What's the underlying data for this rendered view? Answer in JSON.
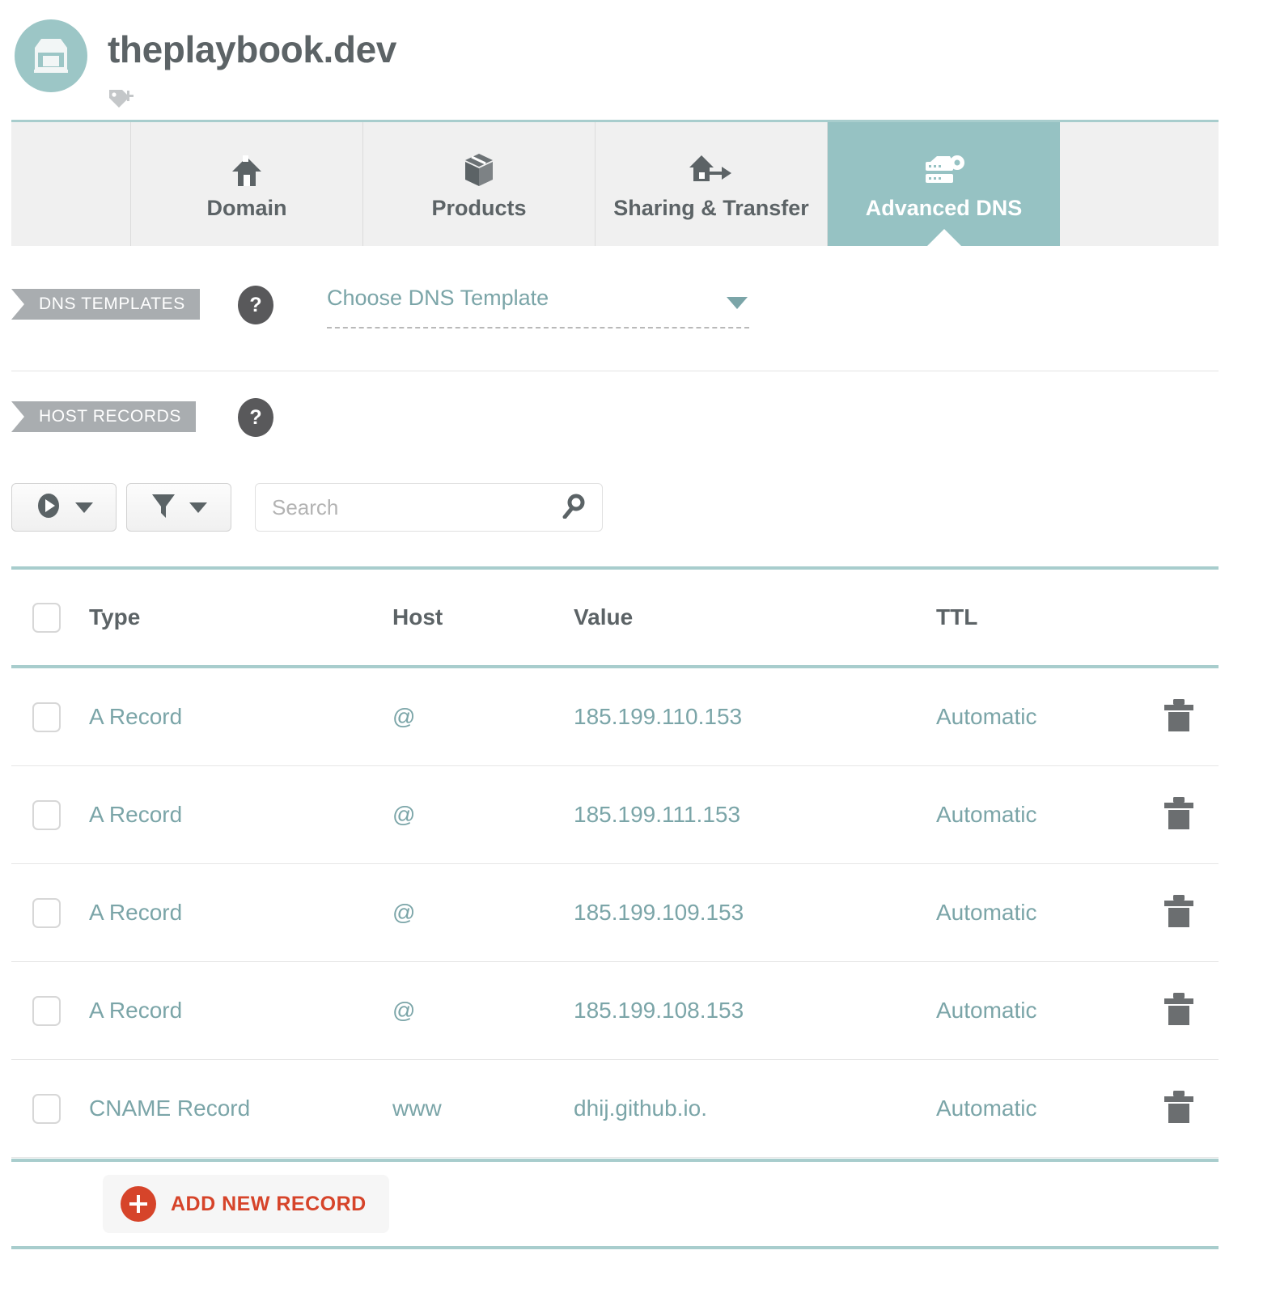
{
  "header": {
    "domain_title": "theplaybook.dev",
    "avatar_icon": "storefront-icon",
    "tag_icon": "tag-add-icon"
  },
  "tabs": [
    {
      "label": "Domain",
      "icon": "home-icon",
      "active": false
    },
    {
      "label": "Products",
      "icon": "box-icon",
      "active": false
    },
    {
      "label": "Sharing & Transfer",
      "icon": "house-arrow-icon",
      "active": false
    },
    {
      "label": "Advanced DNS",
      "icon": "server-gear-icon",
      "active": true
    }
  ],
  "dns_templates": {
    "ribbon_label": "DNS TEMPLATES",
    "help_label": "?",
    "select_value": "Choose DNS Template"
  },
  "host_records": {
    "ribbon_label": "HOST RECORDS",
    "help_label": "?"
  },
  "toolbar": {
    "action_button_icon": "play-circle-icon",
    "filter_button_icon": "funnel-icon",
    "search_placeholder": "Search",
    "search_value": "",
    "search_icon": "magnifier-icon"
  },
  "table": {
    "columns": [
      "Type",
      "Host",
      "Value",
      "TTL"
    ],
    "rows": [
      {
        "type": "A Record",
        "host": "@",
        "value": "185.199.110.153",
        "ttl": "Automatic",
        "delete_icon": "trash-icon"
      },
      {
        "type": "A Record",
        "host": "@",
        "value": "185.199.111.153",
        "ttl": "Automatic",
        "delete_icon": "trash-icon"
      },
      {
        "type": "A Record",
        "host": "@",
        "value": "185.199.109.153",
        "ttl": "Automatic",
        "delete_icon": "trash-icon"
      },
      {
        "type": "A Record",
        "host": "@",
        "value": "185.199.108.153",
        "ttl": "Automatic",
        "delete_icon": "trash-icon"
      },
      {
        "type": "CNAME Record",
        "host": "www",
        "value": "dhij.github.io.",
        "ttl": "Automatic",
        "delete_icon": "trash-icon"
      }
    ]
  },
  "footer": {
    "add_record_label": "ADD NEW RECORD",
    "add_record_icon": "plus-circle-icon"
  },
  "colors": {
    "teal": "#96c2c3",
    "teal_rule": "#a8cdcd",
    "teal_text": "#7ba5a8",
    "gray_text": "#5c6366",
    "ribbon_gray": "#a9adb0",
    "help_dark": "#59595b",
    "accent_red": "#d6442a"
  }
}
